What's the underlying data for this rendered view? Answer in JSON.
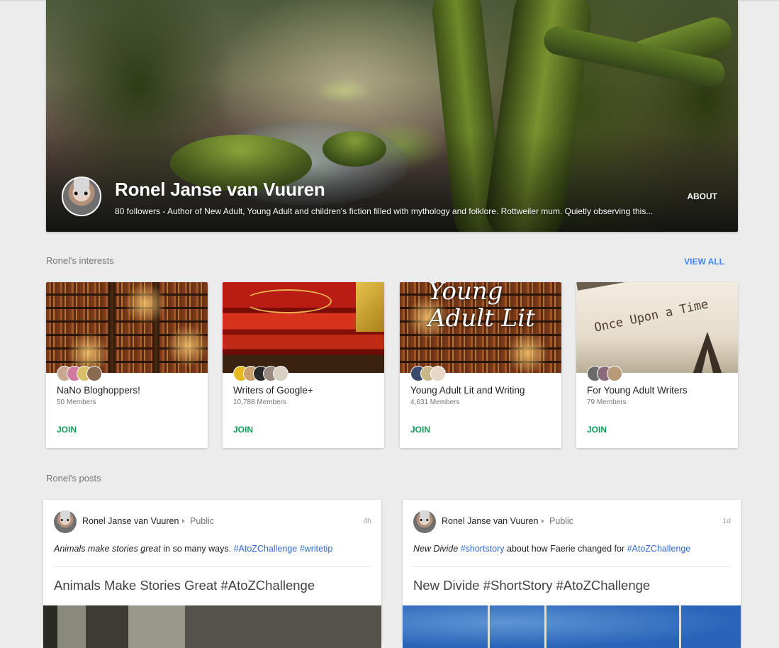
{
  "profile": {
    "name": "Ronel Janse van Vuuren",
    "tagline": "80 followers - Author of New Adult, Young Adult and children's fiction filled with mythology and folklore. Rottweiler mum. Quietly observing this...",
    "about_label": "ABOUT"
  },
  "interests": {
    "heading": "Ronel's interests",
    "view_all_label": "VIEW ALL",
    "cards": [
      {
        "title": "NaNo Bloghoppers!",
        "members": "50 Members",
        "join_label": "JOIN"
      },
      {
        "title": "Writers of Google+",
        "members": "10,788 Members",
        "join_label": "JOIN"
      },
      {
        "title": "Young Adult Lit and Writing",
        "members": "4,631 Members",
        "join_label": "JOIN",
        "image_text": "Young Adult Lit"
      },
      {
        "title": "For Young Adult Writers",
        "members": "79 Members",
        "join_label": "JOIN",
        "image_text": "Once Upon a Time"
      }
    ]
  },
  "posts": {
    "heading": "Ronel's posts",
    "items": [
      {
        "author": "Ronel Janse van Vuuren",
        "visibility": "Public",
        "time": "4h",
        "body_italic": "Animals make stories great",
        "body_plain": " in so many ways. ",
        "body_tags": [
          "#AtoZChallenge",
          "#writetip"
        ],
        "title": "Animals Make Stories Great #AtoZChallenge"
      },
      {
        "author": "Ronel Janse van Vuuren",
        "visibility": "Public",
        "time": "1d",
        "body_italic": "New Divide",
        "body_tag_1": "#shortstory",
        "body_plain": " about how Faerie changed for ",
        "body_tag_2": "#AtoZChallenge",
        "title": "New Divide #ShortStory #AtoZChallenge"
      }
    ]
  },
  "colors": {
    "background": "#ececec",
    "link_blue": "#4285f4",
    "hashtag_blue": "#3367d6",
    "join_green": "#0f9d58"
  }
}
